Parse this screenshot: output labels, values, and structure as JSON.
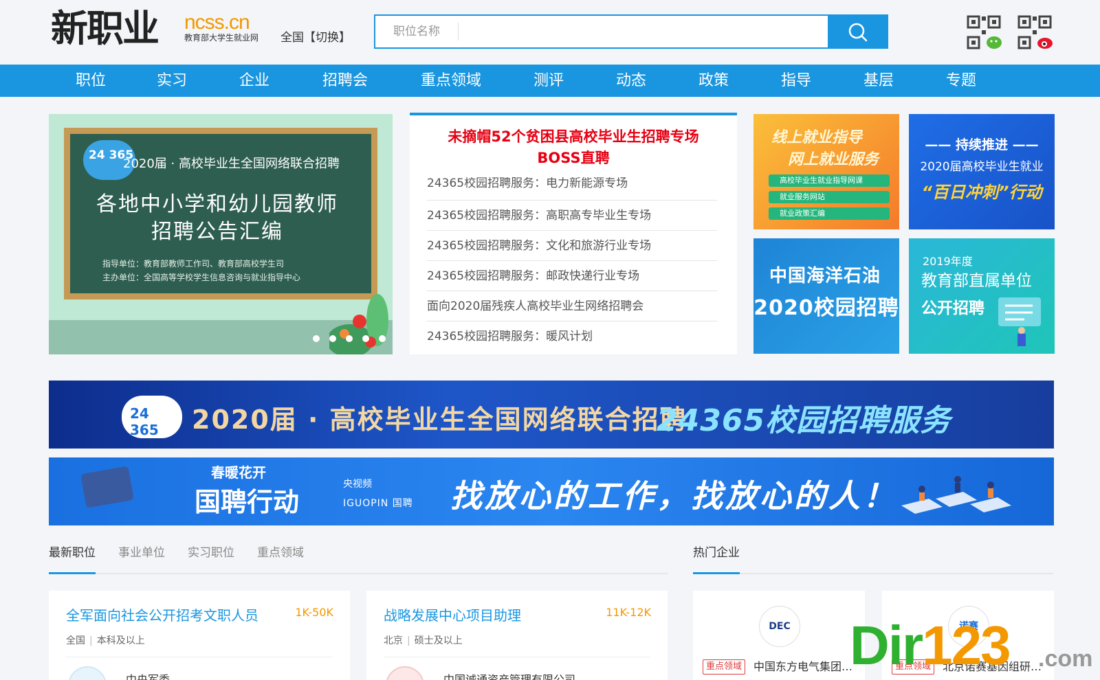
{
  "header": {
    "logo_text": "新职业",
    "logo_site": "ncss.cn",
    "logo_sub": "教育部大学生就业网",
    "region": "全国【切换】",
    "search_placeholder": "职位名称"
  },
  "nav": [
    "职位",
    "实习",
    "企业",
    "招聘会",
    "重点领域",
    "测评",
    "动态",
    "政策",
    "指导",
    "基层",
    "专题"
  ],
  "carousel": {
    "logo": "24 365",
    "small_title": "2020届 · 高校毕业生全国网络联合招聘",
    "big_title_1": "各地中小学和幼儿园教师",
    "big_title_2": "招聘公告汇编",
    "note_1": "指导单位：教育部教师工作司、教育部高校学生司",
    "note_2": "主办单位：全国高等学校学生信息咨询与就业指导中心",
    "active_slide": 1,
    "slide_count": 5
  },
  "news": {
    "headline_1": "未摘帽52个贫困县高校毕业生招聘专场",
    "headline_2": "BOSS直聘",
    "items": [
      "24365校园招聘服务：电力新能源专场",
      "24365校园招聘服务：高职高专毕业生专场",
      "24365校园招聘服务：文化和旅游行业专场",
      "24365校园招聘服务：邮政快递行业专场",
      "面向2020届残疾人高校毕业生网络招聘会",
      "24365校园招聘服务：暖风计划"
    ]
  },
  "tiles": {
    "t1": {
      "line1": "线上就业指导",
      "line2": "网上就业服务",
      "pills": [
        "高校毕业生就业指导网课",
        "就业服务网站",
        "就业政策汇编"
      ]
    },
    "t2": {
      "line1": "—— 持续推进 ——",
      "line2": "2020届高校毕业生就业",
      "line3": "“百日冲刺”行动"
    },
    "t3": {
      "line1": "中国海洋石油",
      "line2": "2020校园招聘"
    },
    "t4": {
      "line0": "2019年度",
      "line1": "教育部直属单位",
      "line2": "公开招聘"
    }
  },
  "banner1": {
    "logo": "24 365",
    "text": "2020届 · 高校毕业生全国网络联合招聘",
    "text2": "24365校园招聘服务"
  },
  "banner2": {
    "sub": "春暖花开",
    "main": "国聘行动",
    "cctv": "央视频",
    "iguo": "IGUOPIN 国聘",
    "slogan": "找放心的工作，找放心的人！"
  },
  "tabs": [
    "最新职位",
    "事业单位",
    "实习职位",
    "重点领域"
  ],
  "hot_label": "热门企业",
  "jobs": [
    {
      "title": "全军面向社会公开招考文职人员",
      "salary": "1K-50K",
      "location": "全国",
      "edu": "本科及以上",
      "company": "中央军委"
    },
    {
      "title": "战略发展中心项目助理",
      "salary": "11K-12K",
      "location": "北京",
      "edu": "硕士及以上",
      "company": "中国诚通资产管理有限公司"
    }
  ],
  "companies": [
    {
      "logo": "DEC",
      "tag": "重点领域",
      "name": "中国东方电气集团有限公司"
    },
    {
      "logo": "诺赛",
      "tag": "重点领域",
      "name": "北京诺赛基因组研究中心"
    }
  ],
  "watermark": {
    "main_a": "Dir",
    "main_b": "123",
    "suffix": ".com"
  },
  "colors": {
    "brand_blue": "#1a96e0",
    "orange": "#f39800",
    "red": "#e60012"
  }
}
